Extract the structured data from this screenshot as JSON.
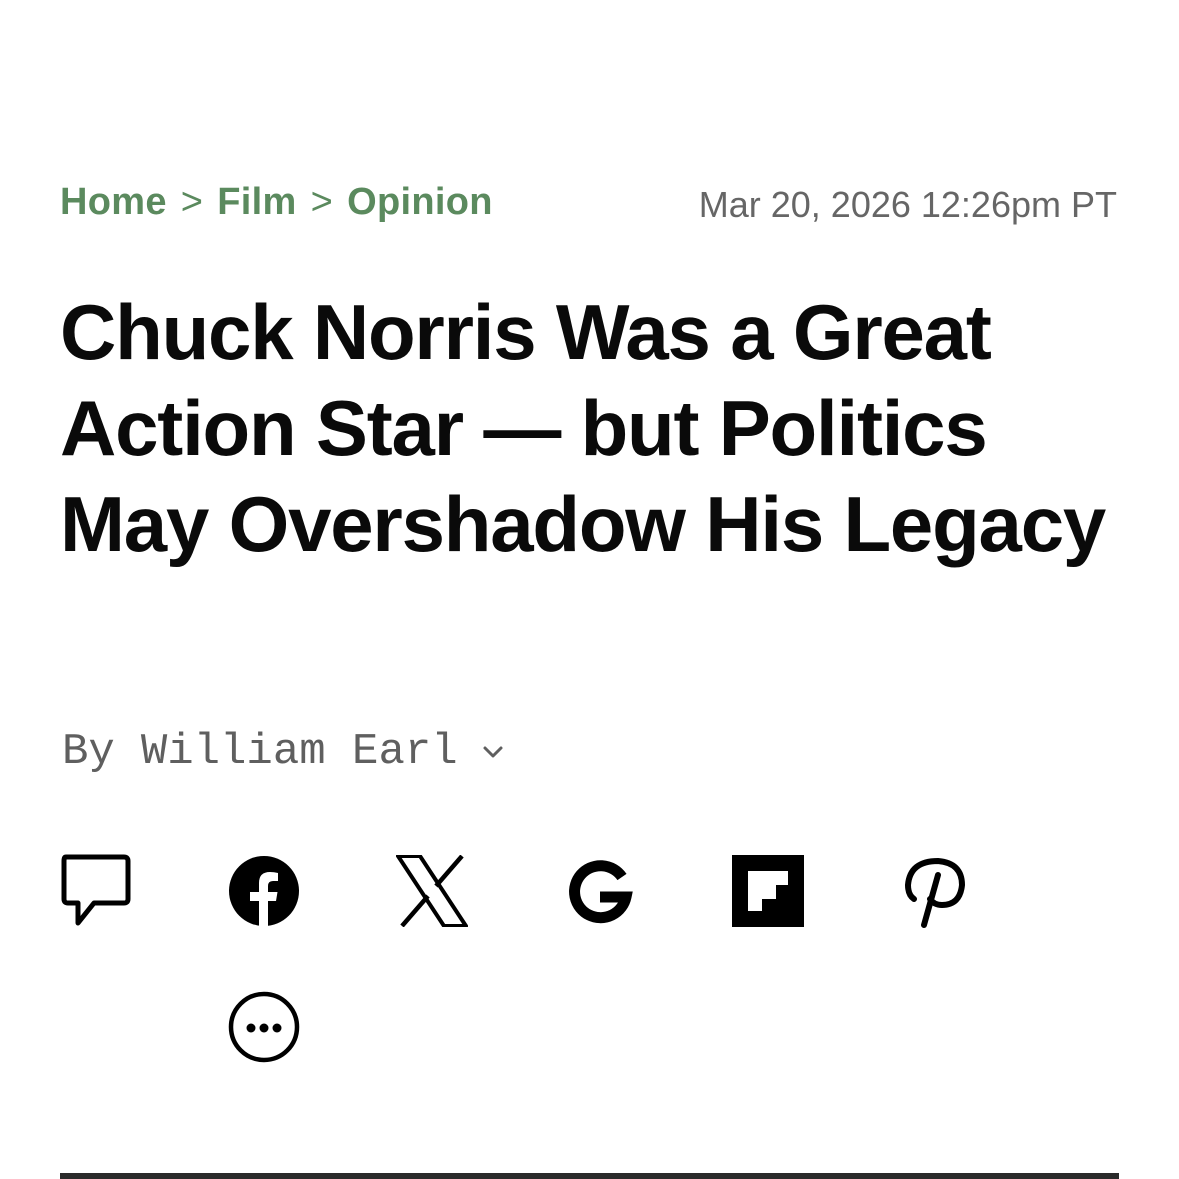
{
  "breadcrumb": {
    "items": [
      "Home",
      "Film",
      "Opinion"
    ],
    "separator": ">"
  },
  "timestamp": "Mar 20, 2026 12:26pm PT",
  "headline": "Chuck Norris Was a Great Action Star — but Politics May Overshadow His Legacy",
  "byline": {
    "prefix": "By",
    "author": "William Earl"
  },
  "share_icons": [
    "comment-icon",
    "facebook-icon",
    "x-icon",
    "google-icon",
    "flipboard-icon",
    "pinterest-icon",
    "more-icon"
  ],
  "colors": {
    "breadcrumb": "#5b8a5e",
    "timestamp": "#666666",
    "headline": "#0a0a0a",
    "byline": "#5f5f5f"
  }
}
